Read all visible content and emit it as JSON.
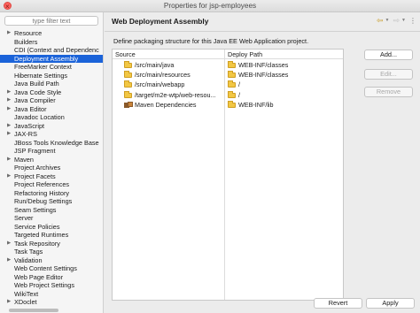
{
  "window": {
    "title": "Properties for jsp-employees"
  },
  "sidebar": {
    "filter_placeholder": "type filter text",
    "items": [
      {
        "label": "Resource",
        "expandable": true
      },
      {
        "label": "Builders",
        "expandable": false
      },
      {
        "label": "CDI (Context and Dependenc",
        "expandable": false
      },
      {
        "label": "Deployment Assembly",
        "expandable": false,
        "selected": true
      },
      {
        "label": "FreeMarker Context",
        "expandable": false
      },
      {
        "label": "Hibernate Settings",
        "expandable": false
      },
      {
        "label": "Java Build Path",
        "expandable": false
      },
      {
        "label": "Java Code Style",
        "expandable": true
      },
      {
        "label": "Java Compiler",
        "expandable": true
      },
      {
        "label": "Java Editor",
        "expandable": true
      },
      {
        "label": "Javadoc Location",
        "expandable": false
      },
      {
        "label": "JavaScript",
        "expandable": true
      },
      {
        "label": "JAX-RS",
        "expandable": true
      },
      {
        "label": "JBoss Tools Knowledge Base",
        "expandable": false
      },
      {
        "label": "JSP Fragment",
        "expandable": false
      },
      {
        "label": "Maven",
        "expandable": true
      },
      {
        "label": "Project Archives",
        "expandable": false
      },
      {
        "label": "Project Facets",
        "expandable": true
      },
      {
        "label": "Project References",
        "expandable": false
      },
      {
        "label": "Refactoring History",
        "expandable": false
      },
      {
        "label": "Run/Debug Settings",
        "expandable": false
      },
      {
        "label": "Seam Settings",
        "expandable": false
      },
      {
        "label": "Server",
        "expandable": false
      },
      {
        "label": "Service Policies",
        "expandable": false
      },
      {
        "label": "Targeted Runtimes",
        "expandable": false
      },
      {
        "label": "Task Repository",
        "expandable": true
      },
      {
        "label": "Task Tags",
        "expandable": false
      },
      {
        "label": "Validation",
        "expandable": true
      },
      {
        "label": "Web Content Settings",
        "expandable": false
      },
      {
        "label": "Web Page Editor",
        "expandable": false
      },
      {
        "label": "Web Project Settings",
        "expandable": false
      },
      {
        "label": "WikiText",
        "expandable": false
      },
      {
        "label": "XDoclet",
        "expandable": true
      }
    ]
  },
  "page": {
    "title": "Web Deployment Assembly",
    "description": "Define packaging structure for this Java EE Web Application project."
  },
  "table": {
    "columns": [
      "Source",
      "Deploy Path"
    ],
    "rows": [
      {
        "source": "/src/main/java",
        "source_icon": "folder-icon",
        "deploy": "WEB-INF/classes"
      },
      {
        "source": "/src/main/resources",
        "source_icon": "folder-icon",
        "deploy": "WEB-INF/classes"
      },
      {
        "source": "/src/main/webapp",
        "source_icon": "folder-icon",
        "deploy": "/"
      },
      {
        "source": "/target/m2e-wtp/web-resou...",
        "source_icon": "folder-icon",
        "deploy": "/"
      },
      {
        "source": "Maven Dependencies",
        "source_icon": "library-icon",
        "deploy": "WEB-INF/lib"
      }
    ]
  },
  "buttons": {
    "add": "Add...",
    "edit": "Edit...",
    "remove": "Remove",
    "revert": "Revert",
    "apply": "Apply"
  },
  "icons": {
    "back": "back-arrow-icon",
    "forward": "forward-arrow-icon",
    "menu": "view-menu-icon"
  },
  "colors": {
    "selection": "#1b63d9",
    "folder": "#f2c744"
  }
}
